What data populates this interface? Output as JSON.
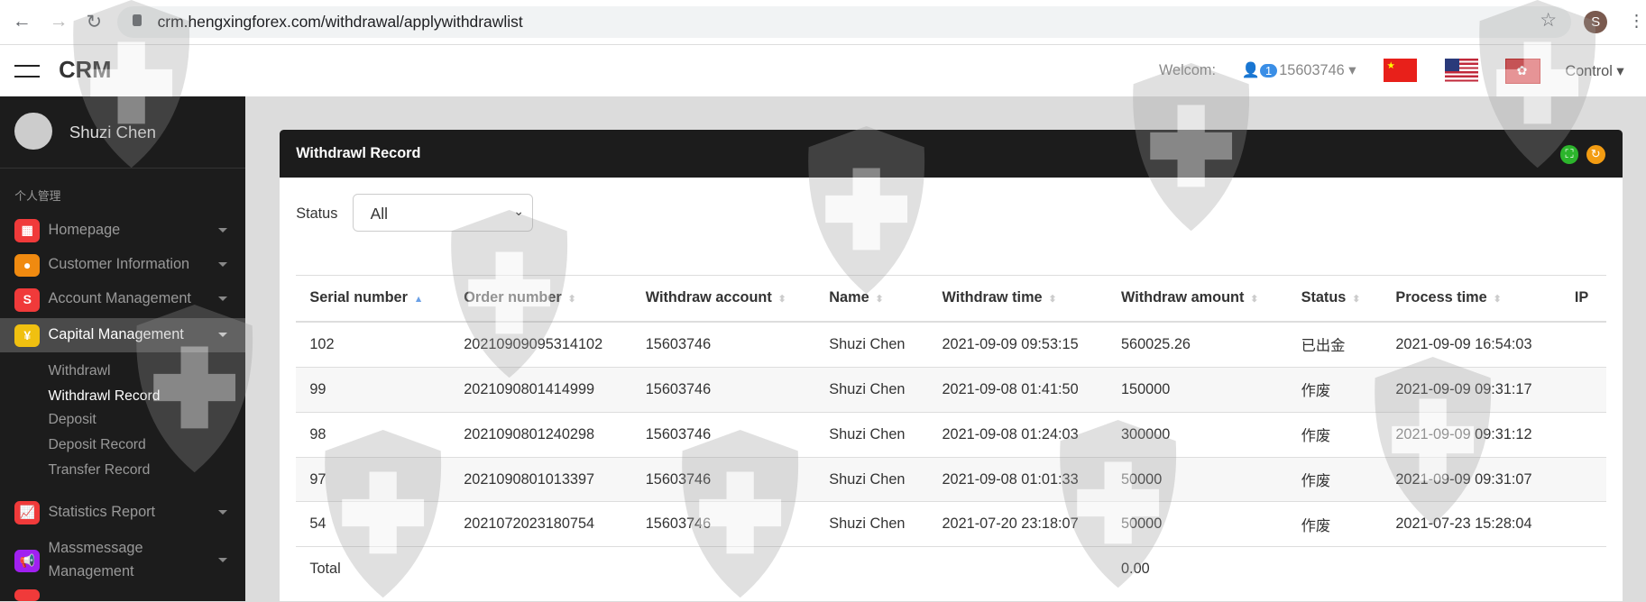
{
  "browser": {
    "url": "crm.hengxingforex.com/withdrawal/applywithdrawlist",
    "profile_initial": "S"
  },
  "header": {
    "brand": "CRM",
    "welcome": "Welcom:",
    "badge": "1",
    "account": "15603746",
    "control": "Control"
  },
  "sidebar": {
    "user": "Shuzi Chen",
    "section": "个人管理",
    "items": [
      {
        "label": "Homepage",
        "color": "#f03a3a"
      },
      {
        "label": "Customer Information",
        "color": "#f08a10"
      },
      {
        "label": "Account Management",
        "color": "#f03a3a"
      },
      {
        "label": "Capital Management",
        "color": "#f0c010"
      }
    ],
    "sub": [
      "Withdrawl",
      "Withdrawl Record",
      "Deposit",
      "Deposit Record",
      "Transfer Record"
    ],
    "items2": [
      {
        "label": "Statistics Report",
        "color": "#f03a3a"
      },
      {
        "label": "Massmessage Management",
        "color": "#a020f0"
      }
    ]
  },
  "card": {
    "title": "Withdrawl Record",
    "status_label": "Status",
    "status_value": "All",
    "columns": [
      "Serial number",
      "Order number",
      "Withdraw account",
      "Name",
      "Withdraw time",
      "Withdraw amount",
      "Status",
      "Process time",
      "IP"
    ],
    "rows": [
      [
        "102",
        "20210909095314102",
        "15603746",
        "Shuzi Chen",
        "2021-09-09 09:53:15",
        "560025.26",
        "已出金",
        "2021-09-09 16:54:03",
        ""
      ],
      [
        "99",
        "2021090801414999",
        "15603746",
        "Shuzi Chen",
        "2021-09-08 01:41:50",
        "150000",
        "作废",
        "2021-09-09 09:31:17",
        ""
      ],
      [
        "98",
        "2021090801240298",
        "15603746",
        "Shuzi Chen",
        "2021-09-08 01:24:03",
        "300000",
        "作废",
        "2021-09-09 09:31:12",
        ""
      ],
      [
        "97",
        "2021090801013397",
        "15603746",
        "Shuzi Chen",
        "2021-09-08 01:01:33",
        "50000",
        "作废",
        "2021-09-09 09:31:07",
        ""
      ],
      [
        "54",
        "2021072023180754",
        "15603746",
        "Shuzi Chen",
        "2021-07-20 23:18:07",
        "50000",
        "作废",
        "2021-07-23 15:28:04",
        ""
      ]
    ],
    "total_label": "Total",
    "total_amount": "0.00"
  }
}
